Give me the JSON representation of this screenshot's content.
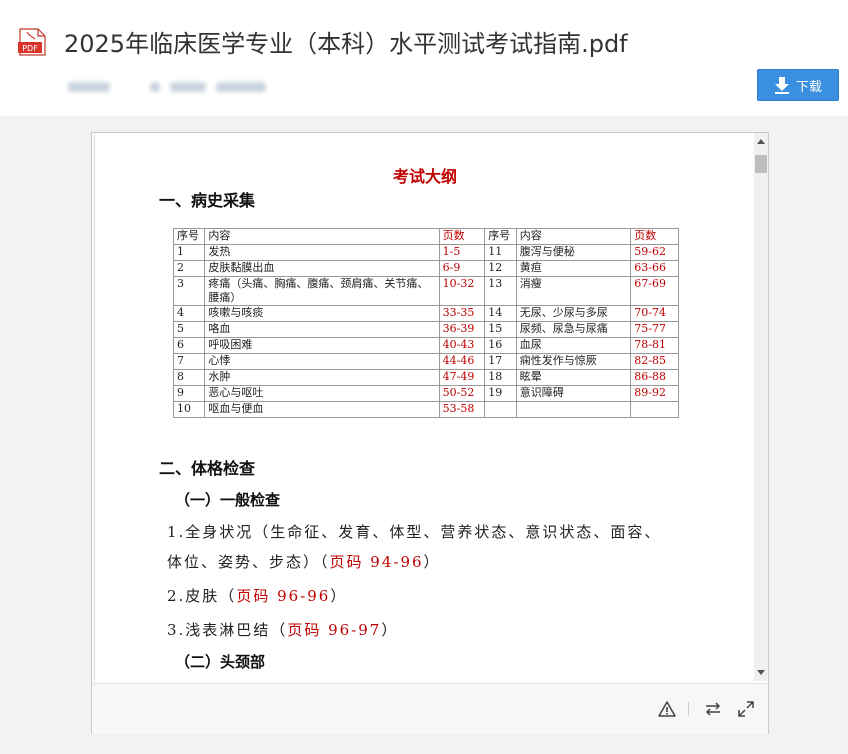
{
  "header": {
    "file_icon": "pdf-file-icon",
    "file_icon_label": "PDF",
    "file_title": "2025年临床医学专业（本科）水平测试考试指南.pdf",
    "download_label": "下载",
    "download_icon": "download-arrow-icon"
  },
  "document": {
    "title": "考试大纲",
    "section1": "一、病史采集",
    "table": {
      "headers": [
        "序号",
        "内容",
        "页数",
        "序号",
        "内容",
        "页数"
      ],
      "rows": [
        {
          "n1": "1",
          "c1": "发热",
          "p1": "1-5",
          "n2": "11",
          "c2": "腹泻与便秘",
          "p2": "59-62"
        },
        {
          "n1": "2",
          "c1": "皮肤黏膜出血",
          "p1": "6-9",
          "n2": "12",
          "c2": "黄疸",
          "p2": "63-66"
        },
        {
          "n1": "3",
          "c1": "疼痛（头痛、胸痛、腹痛、颈肩痛、关节痛、腰痛）",
          "p1": "10-32",
          "n2": "13",
          "c2": "消瘦",
          "p2": "67-69"
        },
        {
          "n1": "4",
          "c1": "咳嗽与咳痰",
          "p1": "33-35",
          "n2": "14",
          "c2": "无尿、少尿与多尿",
          "p2": "70-74"
        },
        {
          "n1": "5",
          "c1": "咯血",
          "p1": "36-39",
          "n2": "15",
          "c2": "尿频、尿急与尿痛",
          "p2": "75-77"
        },
        {
          "n1": "6",
          "c1": "呼吸困难",
          "p1": "40-43",
          "n2": "16",
          "c2": "血尿",
          "p2": "78-81"
        },
        {
          "n1": "7",
          "c1": "心悸",
          "p1": "44-46",
          "n2": "17",
          "c2": "痫性发作与惊厥",
          "p2": "82-85"
        },
        {
          "n1": "8",
          "c1": "水肿",
          "p1": "47-49",
          "n2": "18",
          "c2": "眩晕",
          "p2": "86-88"
        },
        {
          "n1": "9",
          "c1": "恶心与呕吐",
          "p1": "50-52",
          "n2": "19",
          "c2": "意识障碍",
          "p2": "89-92"
        },
        {
          "n1": "10",
          "c1": "呕血与便血",
          "p1": "53-58",
          "n2": "",
          "c2": "",
          "p2": ""
        }
      ]
    },
    "section2": "二、体格检查",
    "sub1": "（一）一般检查",
    "item1_line1": "1.全身状况（生命征、发育、体型、营养状态、意识状态、面容、",
    "item1_line2_text": "体位、姿势、步态）（",
    "item1_pages": "页码 94-96",
    "item1_close": "）",
    "item2_text": "2.皮肤（",
    "item2_pages": "页码 96-96",
    "item2_close": "）",
    "item3_text": "3.浅表淋巴结（",
    "item3_pages": "页码 96-97",
    "item3_close": "）",
    "sub2": "（二）头颈部"
  },
  "toolbar": {
    "icons": [
      "warning-icon",
      "switch-arrows-icon",
      "fullscreen-icon"
    ]
  },
  "colors": {
    "accent_button": "#3b8fe0",
    "doc_red": "#c00000"
  }
}
